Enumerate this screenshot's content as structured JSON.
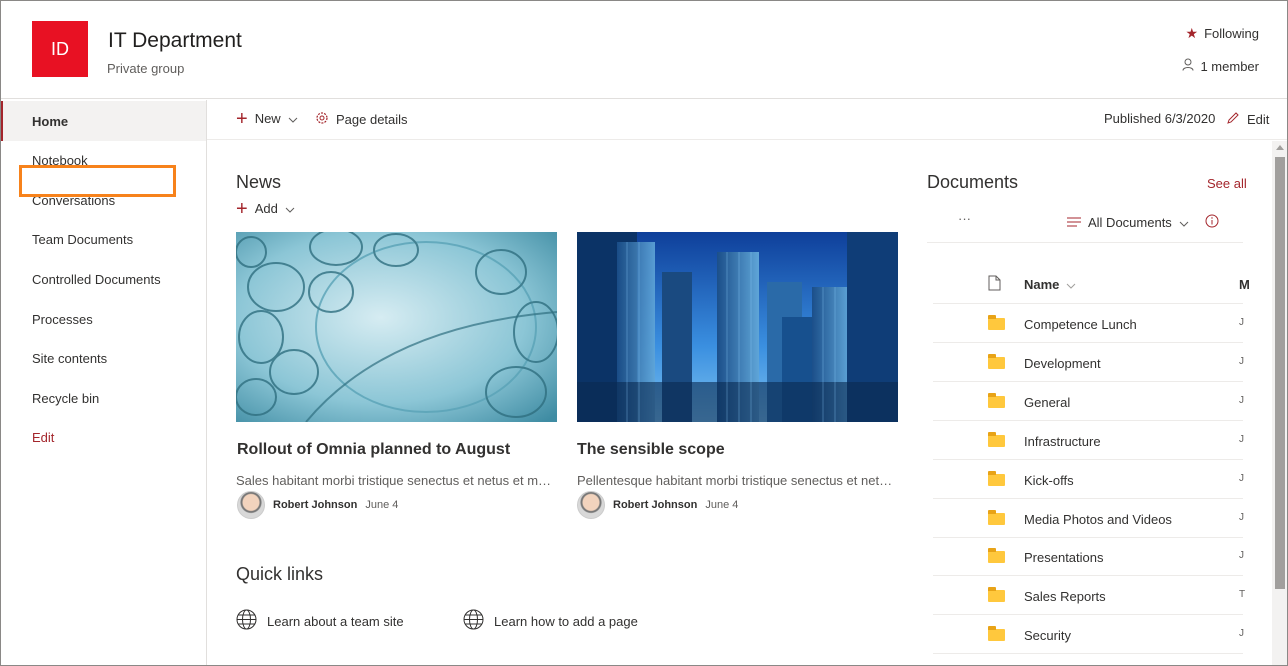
{
  "site": {
    "logo_text": "ID",
    "logo_color": "#e81123",
    "title": "IT Department",
    "subtitle": "Private group",
    "following": "Following",
    "members": "1 member"
  },
  "nav": {
    "items": [
      {
        "label": "Home"
      },
      {
        "label": "Notebook"
      },
      {
        "label": "Conversations"
      },
      {
        "label": "Team Documents"
      },
      {
        "label": "Controlled Documents"
      },
      {
        "label": "Processes"
      },
      {
        "label": "Site contents"
      },
      {
        "label": "Recycle bin"
      },
      {
        "label": "Edit"
      }
    ],
    "active": "Home",
    "highlighted": "Controlled Documents",
    "highlight_color": "#f7821b"
  },
  "commandbar": {
    "new_label": "New",
    "page_details_label": "Page details",
    "published": "Published 6/3/2020",
    "edit_label": "Edit"
  },
  "news": {
    "title": "News",
    "add_label": "Add",
    "cards": [
      {
        "title": "Rollout of Omnia planned to August",
        "description": "Sales habitant morbi tristique senectus et netus et malesuada fames",
        "author": "Robert Johnson",
        "date": "June 4",
        "image": "bubbles"
      },
      {
        "title": "The sensible scope",
        "description": "Pellentesque habitant morbi tristique senectus et netus et malesuada",
        "author": "Robert Johnson",
        "date": "June 4",
        "image": "skyscrapers"
      }
    ]
  },
  "quicklinks": {
    "title": "Quick links",
    "items": [
      {
        "label": "Learn about a team site",
        "icon": "globe-icon"
      },
      {
        "label": "Learn how to add a page",
        "icon": "globe-icon"
      }
    ]
  },
  "documents": {
    "title": "Documents",
    "see_all": "See all",
    "more": "···",
    "view": "All Documents",
    "column_name": "Name",
    "column_modified": "M",
    "rows": [
      {
        "name": "Competence Lunch",
        "modified": "J"
      },
      {
        "name": "Development",
        "modified": "J"
      },
      {
        "name": "General",
        "modified": "J"
      },
      {
        "name": "Infrastructure",
        "modified": "J"
      },
      {
        "name": "Kick-offs",
        "modified": "J"
      },
      {
        "name": "Media Photos and Videos",
        "modified": "J"
      },
      {
        "name": "Presentations",
        "modified": "J"
      },
      {
        "name": "Sales Reports",
        "modified": "T"
      },
      {
        "name": "Security",
        "modified": "J"
      }
    ]
  }
}
